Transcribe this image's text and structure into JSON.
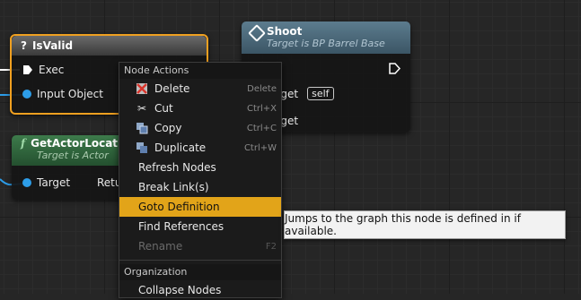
{
  "nodes": {
    "isvalid": {
      "title": "IsValid",
      "pins": {
        "exec": "Exec",
        "input_object": "Input Object"
      }
    },
    "shoot": {
      "title": "Shoot",
      "subtitle": "Target is BP Barrel Base",
      "pins": {
        "target_1": "Target",
        "self_value": "self",
        "target_2": "Target"
      }
    },
    "get_actor_location": {
      "title": "GetActorLocation",
      "subtitle": "Target is Actor",
      "pins": {
        "target": "Target",
        "return": "Return Value"
      }
    }
  },
  "context_menu": {
    "section_node_actions": "Node Actions",
    "items": [
      {
        "label": "Delete",
        "shortcut": "Delete",
        "icon": "delete-icon"
      },
      {
        "label": "Cut",
        "shortcut": "Ctrl+X",
        "icon": "scissors-icon"
      },
      {
        "label": "Copy",
        "shortcut": "Ctrl+C",
        "icon": "copy-icon"
      },
      {
        "label": "Duplicate",
        "shortcut": "Ctrl+W",
        "icon": "duplicate-icon"
      },
      {
        "label": "Refresh Nodes",
        "shortcut": ""
      },
      {
        "label": "Break Link(s)",
        "shortcut": ""
      },
      {
        "label": "Goto Definition",
        "shortcut": "",
        "highlighted": true
      },
      {
        "label": "Find References",
        "shortcut": ""
      },
      {
        "label": "Rename",
        "shortcut": "F2",
        "disabled": true
      }
    ],
    "section_organization": "Organization",
    "organization_items": [
      {
        "label": "Collapse Nodes"
      }
    ]
  },
  "tooltip": {
    "text": "Jumps to the graph this node is defined in if available."
  },
  "colors": {
    "highlight": "#e2a419",
    "selected_node_border": "#f0a020",
    "object_pin": "#2d9de8",
    "function_header": "#5c7c8e",
    "pure_function_header": "#3d7b4b"
  }
}
